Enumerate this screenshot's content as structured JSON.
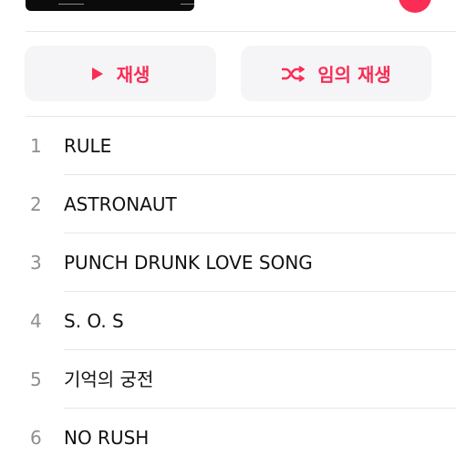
{
  "actions": {
    "play_label": "재생",
    "shuffle_label": "임의 재생"
  },
  "colors": {
    "accent": "#fa2d55",
    "button_bg": "#f5f5f7",
    "track_number": "#8e8e93",
    "divider": "#e6e6e8"
  },
  "tracks": [
    {
      "number": "1",
      "title": "RULE"
    },
    {
      "number": "2",
      "title": "ASTRONAUT"
    },
    {
      "number": "3",
      "title": "PUNCH DRUNK LOVE SONG"
    },
    {
      "number": "4",
      "title": "S. O. S"
    },
    {
      "number": "5",
      "title": "기억의 궁전"
    },
    {
      "number": "6",
      "title": "NO RUSH"
    }
  ]
}
